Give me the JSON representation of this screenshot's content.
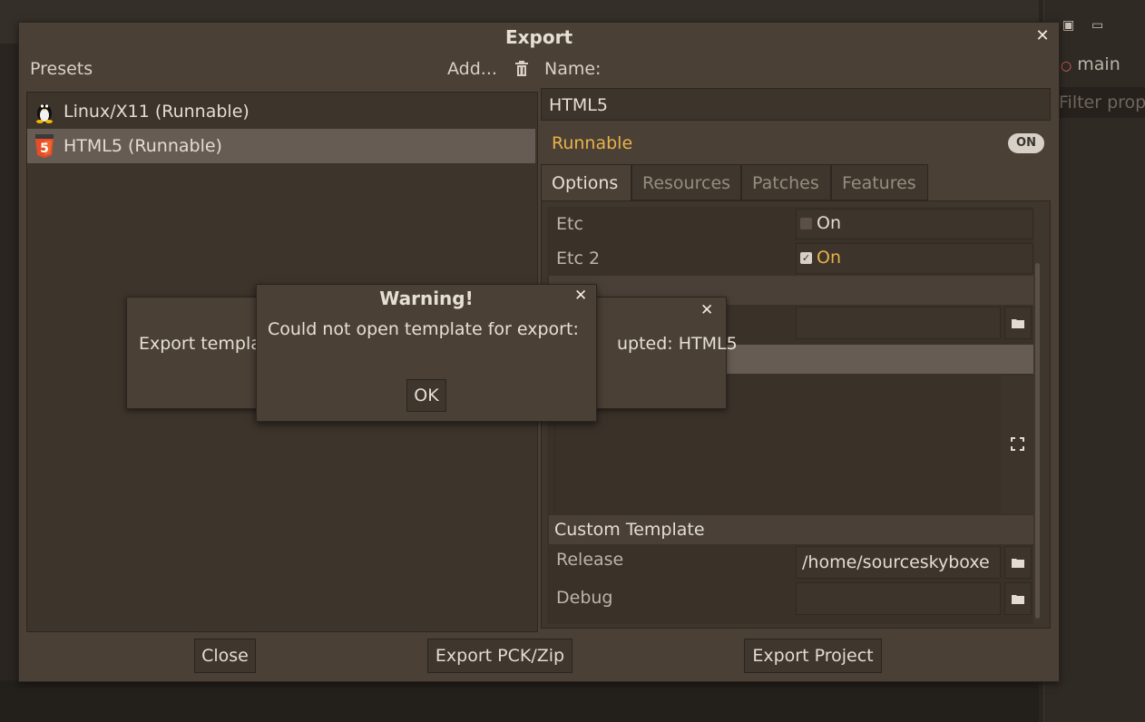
{
  "background": {
    "right_panel": {
      "tab_label": "main",
      "filter_placeholder": "Filter prop"
    }
  },
  "export_dialog": {
    "title": "Export",
    "presets_label": "Presets",
    "add_label": "Add...",
    "presets": [
      {
        "label": "Linux/X11 (Runnable)",
        "icon": "linux-icon",
        "selected": false
      },
      {
        "label": "HTML5 (Runnable)",
        "icon": "html5-icon",
        "selected": true
      }
    ],
    "name_label": "Name:",
    "name_value": "HTML5",
    "runnable_label": "Runnable",
    "runnable_toggle": "ON",
    "tabs": [
      "Options",
      "Resources",
      "Patches",
      "Features"
    ],
    "options": {
      "etc_label": "Etc",
      "etc_value": "On",
      "etc2_label": "Etc 2",
      "etc2_value": "On",
      "custom_template_label": "Custom Template",
      "release_label": "Release",
      "release_value": "/home/sourceskyboxe",
      "debug_label": "Debug"
    },
    "buttons": {
      "close": "Close",
      "export_pck": "Export PCK/Zip",
      "export_project": "Export Project"
    }
  },
  "background_popup": {
    "text_left": "Export templa",
    "text_right": "upted: HTML5"
  },
  "warning": {
    "title": "Warning!",
    "message": "Could not open template for export:",
    "ok": "OK"
  },
  "colors": {
    "accent": "#e8b24a",
    "dialog_bg": "#4b4036",
    "selection": "#665c54"
  }
}
